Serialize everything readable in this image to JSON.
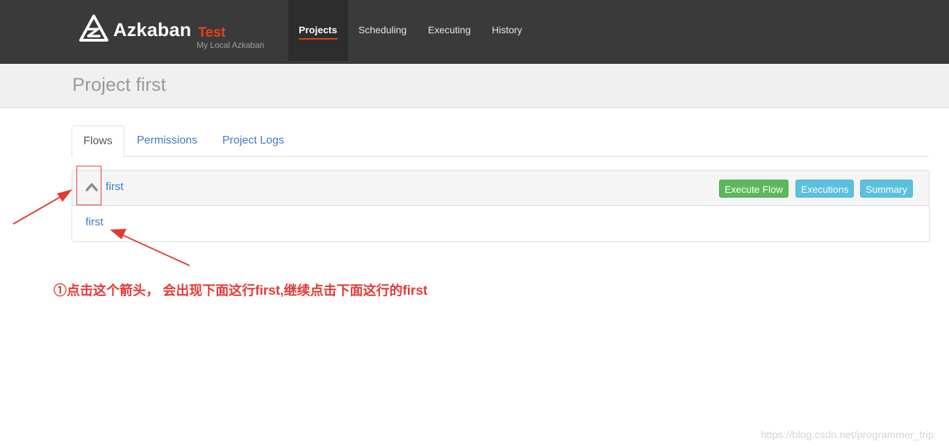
{
  "navbar": {
    "brand": "Azkaban",
    "environment": "Test",
    "subtitle": "My Local Azkaban",
    "items": [
      {
        "label": "Projects",
        "active": true
      },
      {
        "label": "Scheduling",
        "active": false
      },
      {
        "label": "Executing",
        "active": false
      },
      {
        "label": "History",
        "active": false
      }
    ]
  },
  "page": {
    "title": "Project first"
  },
  "tabs": [
    {
      "label": "Flows",
      "active": true
    },
    {
      "label": "Permissions",
      "active": false
    },
    {
      "label": "Project Logs",
      "active": false
    }
  ],
  "flow": {
    "name": "first",
    "expand_icon": "chevron-up-icon",
    "buttons": {
      "execute": "Execute Flow",
      "executions": "Executions",
      "summary": "Summary"
    },
    "jobs": [
      {
        "name": "first"
      }
    ]
  },
  "annotation": {
    "note": "①点击这个箭头， 会出现下面这行first,继续点击下面这行的first"
  },
  "watermark": "https://blog.csdn.net/programmer_trip",
  "colors": {
    "navbar_bg": "#3a3a3a",
    "accent": "#e8401c",
    "link": "#3a7cbf",
    "success": "#5cb85c",
    "info": "#5bc0de",
    "annotation": "#e53935"
  }
}
